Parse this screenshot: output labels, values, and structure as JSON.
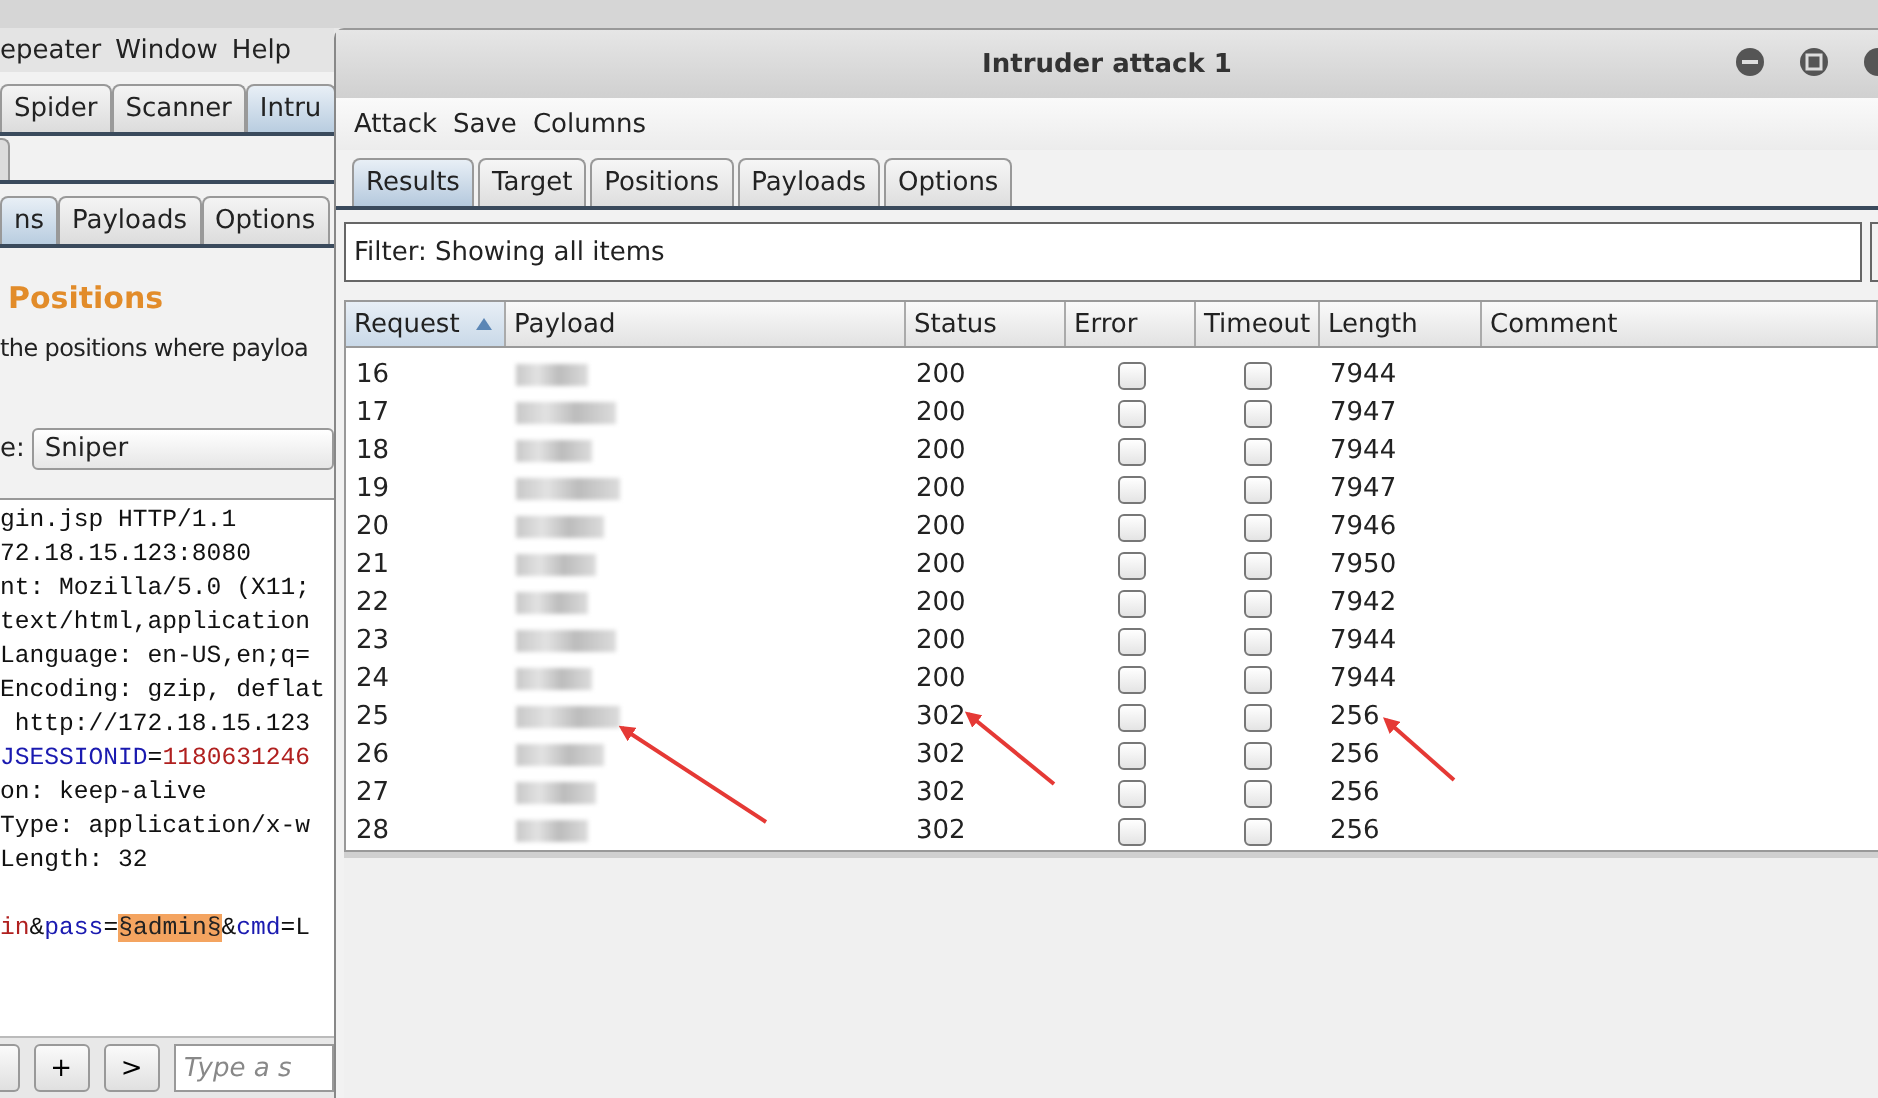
{
  "main_window": {
    "menu": [
      "epeater",
      "Window",
      "Help"
    ],
    "tool_tabs": [
      {
        "label": "Spider",
        "selected": false
      },
      {
        "label": "Scanner",
        "selected": false
      },
      {
        "label": "Intru",
        "selected": true
      }
    ],
    "sub_tabs": [
      {
        "label": "ns",
        "selected": true
      },
      {
        "label": "Payloads",
        "selected": false
      },
      {
        "label": "Options",
        "selected": false
      }
    ],
    "heading": "Positions",
    "description": "the positions where payloa",
    "attack_type": {
      "label": "e:",
      "value": "Sniper"
    },
    "request_lines": [
      {
        "kind": "header",
        "segments": [
          {
            "text": "gin.jsp HTTP/1.1",
            "kind": "plain"
          }
        ]
      },
      {
        "kind": "header",
        "segments": [
          {
            "text": "72.18.15.123:8080",
            "kind": "plain"
          }
        ]
      },
      {
        "kind": "header",
        "segments": [
          {
            "text": "nt: Mozilla/5.0 (X11;",
            "kind": "plain"
          }
        ]
      },
      {
        "kind": "header",
        "segments": [
          {
            "text": "text/html,application",
            "kind": "plain"
          }
        ]
      },
      {
        "kind": "header",
        "segments": [
          {
            "text": "Language: en-US,en;q=",
            "kind": "plain"
          }
        ]
      },
      {
        "kind": "header",
        "segments": [
          {
            "text": "Encoding: gzip, deflat",
            "kind": "plain"
          }
        ]
      },
      {
        "kind": "header",
        "segments": [
          {
            "text": " http://172.18.15.123",
            "kind": "plain"
          }
        ]
      },
      {
        "kind": "header",
        "segments": [
          {
            "text": "JSESSIONID",
            "kind": "name"
          },
          {
            "text": "=",
            "kind": "plain"
          },
          {
            "text": "1180631246",
            "kind": "value"
          }
        ]
      },
      {
        "kind": "header",
        "segments": [
          {
            "text": "on: keep-alive",
            "kind": "plain"
          }
        ]
      },
      {
        "kind": "header",
        "segments": [
          {
            "text": "Type: application/x-w",
            "kind": "plain"
          }
        ]
      },
      {
        "kind": "header",
        "segments": [
          {
            "text": "Length: 32",
            "kind": "plain"
          }
        ]
      },
      {
        "kind": "body",
        "segments": [
          {
            "text": "in",
            "kind": "value"
          },
          {
            "text": "&",
            "kind": "plain"
          },
          {
            "text": "pass",
            "kind": "name"
          },
          {
            "text": "=",
            "kind": "plain"
          },
          {
            "text": "§admin§",
            "kind": "marker"
          },
          {
            "text": "&",
            "kind": "plain"
          },
          {
            "text": "cmd",
            "kind": "name"
          },
          {
            "text": "=L",
            "kind": "plain"
          }
        ]
      }
    ],
    "bottom_buttons": [
      "+",
      ">"
    ],
    "search": {
      "placeholder": "Type a s"
    }
  },
  "attack_window": {
    "title": "Intruder attack 1",
    "menu": [
      "Attack",
      "Save",
      "Columns"
    ],
    "tabs": [
      {
        "label": "Results",
        "selected": true
      },
      {
        "label": "Target",
        "selected": false
      },
      {
        "label": "Positions",
        "selected": false
      },
      {
        "label": "Payloads",
        "selected": false
      },
      {
        "label": "Options",
        "selected": false
      }
    ],
    "filter": "Filter: Showing all items",
    "table": {
      "columns": [
        "Request",
        "Payload",
        "Status",
        "Error",
        "Timeout",
        "Length",
        "Comment"
      ],
      "rows": [
        {
          "request": "16",
          "status": "200",
          "error": false,
          "timeout": false,
          "length": "7944"
        },
        {
          "request": "17",
          "status": "200",
          "error": false,
          "timeout": false,
          "length": "7947"
        },
        {
          "request": "18",
          "status": "200",
          "error": false,
          "timeout": false,
          "length": "7944"
        },
        {
          "request": "19",
          "status": "200",
          "error": false,
          "timeout": false,
          "length": "7947"
        },
        {
          "request": "20",
          "status": "200",
          "error": false,
          "timeout": false,
          "length": "7946"
        },
        {
          "request": "21",
          "status": "200",
          "error": false,
          "timeout": false,
          "length": "7950"
        },
        {
          "request": "22",
          "status": "200",
          "error": false,
          "timeout": false,
          "length": "7942"
        },
        {
          "request": "23",
          "status": "200",
          "error": false,
          "timeout": false,
          "length": "7944"
        },
        {
          "request": "24",
          "status": "200",
          "error": false,
          "timeout": false,
          "length": "7944"
        },
        {
          "request": "25",
          "status": "302",
          "error": false,
          "timeout": false,
          "length": "256"
        },
        {
          "request": "26",
          "status": "302",
          "error": false,
          "timeout": false,
          "length": "256"
        },
        {
          "request": "27",
          "status": "302",
          "error": false,
          "timeout": false,
          "length": "256"
        },
        {
          "request": "28",
          "status": "302",
          "error": false,
          "timeout": false,
          "length": "256"
        }
      ]
    }
  }
}
